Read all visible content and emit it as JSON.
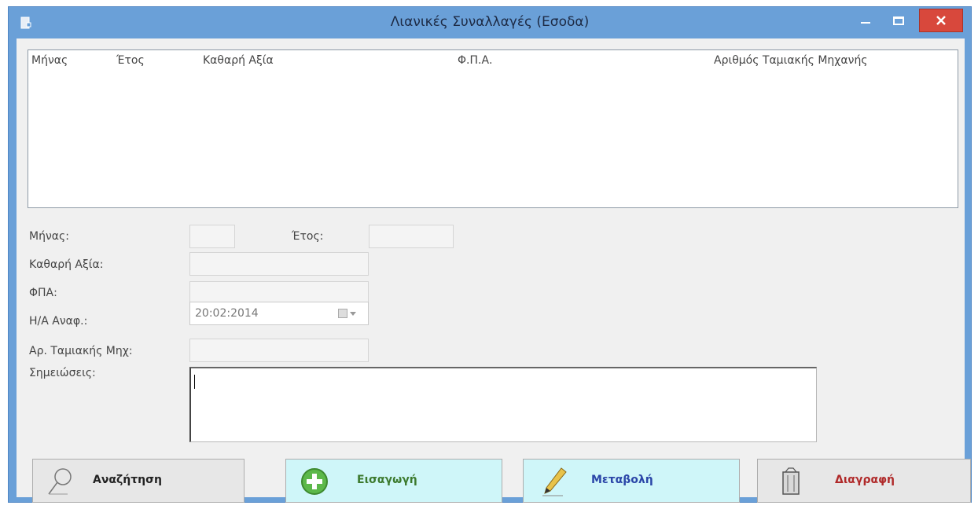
{
  "window": {
    "title": "Λιανικές Συναλλαγές (Εσοδα)"
  },
  "list": {
    "columns": [
      "Μήνας",
      "Έτος",
      "Καθαρή Αξία",
      "Φ.Π.Α.",
      "Αριθμός Ταμιακής Μηχανής"
    ],
    "rows": []
  },
  "form": {
    "month_label": "Μήνας:",
    "year_label": "Έτος:",
    "net_value_label": "Καθαρή Αξία:",
    "vat_label": "ΦΠΑ:",
    "date_label": "Η/Α Αναφ.:",
    "date_value": "20:02:2014",
    "register_label": "Αρ. Ταμιακής Μηχ:",
    "notes_label": "Σημειώσεις:",
    "month_value": "",
    "year_value": "",
    "net_value": "",
    "vat_value": "",
    "register_value": "",
    "notes_value": ""
  },
  "buttons": {
    "search": "Αναζήτηση",
    "insert": "Εισαγωγή",
    "edit": "Μεταβολή",
    "delete": "Διαγραφή"
  },
  "colors": {
    "titlebar": "#6aa0d8",
    "close": "#d8483c",
    "action_highlight": "#cff6f9"
  },
  "icons": {
    "app": "app-icon",
    "search": "magnifier-icon",
    "insert": "plus-circle-icon",
    "edit": "pencil-icon",
    "delete": "trash-icon"
  }
}
